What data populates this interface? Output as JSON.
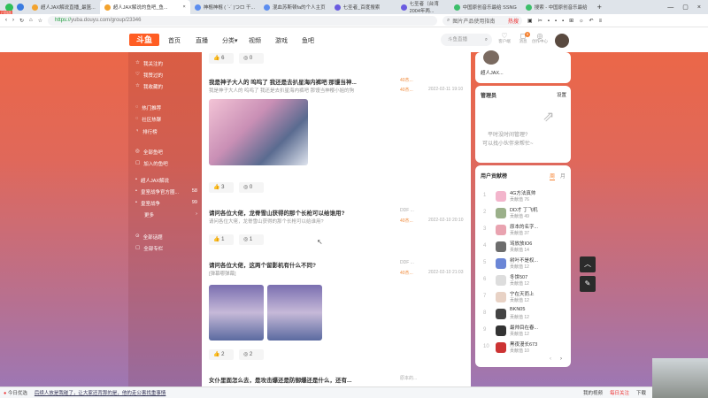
{
  "browser": {
    "tabs": [
      "超人JAX解说直播_最篮...",
      "超人JAX解说的鱼吧_鱼...",
      "神棍神棍 ( `-´ )つロ 干...",
      "混血苏斯顿fa的个人主页",
      "七圣者_百度搜索",
      "七圣者（台湾2004年两...",
      "中国原创音乐最给 SSNG",
      "搜索 - 中国原创音乐最给"
    ],
    "url_prefix": "https://",
    "url": "yuba.douyu.com/group/23346",
    "search_placeholder": "图片产品使用指南",
    "hot": "热搜",
    "badge": "已回声"
  },
  "header": {
    "logo": "斗鱼",
    "nav": [
      "首页",
      "直播",
      "分类▾",
      "视频",
      "游戏",
      "鱼吧"
    ],
    "search_placeholder": "斗鱼直播",
    "icons": [
      {
        "name": "client-icon",
        "label": "客户端"
      },
      {
        "name": "bell-icon",
        "label": "消息",
        "badge": "9"
      },
      {
        "name": "creator-icon",
        "label": "创作中心"
      }
    ]
  },
  "sidebar": {
    "items": [
      {
        "icon": "star-icon",
        "label": "我关注的"
      },
      {
        "icon": "like-icon",
        "label": "我赞过的"
      },
      {
        "icon": "collect-icon",
        "label": "我收藏的"
      },
      {
        "icon": "fire-icon",
        "label": "热门推荐"
      },
      {
        "icon": "chat-icon",
        "label": "社区热聊"
      },
      {
        "icon": "trophy-icon",
        "label": "排行榜"
      },
      {
        "icon": "group-icon",
        "label": "全部鱼吧"
      },
      {
        "icon": "joined-icon",
        "label": "加入的鱼吧"
      },
      {
        "icon": "dot",
        "label": "超人JAX解说",
        "count": ""
      },
      {
        "icon": "dot",
        "label": "皇室战争官方圈...",
        "count": "58"
      },
      {
        "icon": "dot",
        "label": "皇室战争",
        "count": "99"
      },
      {
        "icon": "",
        "label": "更多",
        "count": "›"
      },
      {
        "icon": "topic-icon",
        "label": "全部话题"
      },
      {
        "icon": "column-icon",
        "label": "全部专栏"
      }
    ]
  },
  "posts": [
    {
      "likes": "6",
      "comments": "0"
    },
    {
      "title": "我是神子大人的 呜呜了 我还是去扒星海内裤吧 那馒当神...",
      "sub": "我是神子大人的 呜呜了 我还是去扒星海内裤吧 那馒当神樱小姐的狗",
      "author": "40杰...",
      "level": "40杰...",
      "date": "2022-02-11 19:10",
      "likes": "3",
      "comments": "0"
    },
    {
      "title": "请问各位大佬，龙脊雪山获得的那个长枪可以给谁用?",
      "sub": "请问各位大佬，龙脊雪山获得的那个长枪可以给谁用?",
      "author": "DDF ...",
      "level": "40杰...",
      "date": "2022-02-10 20:10",
      "likes": "1",
      "comments": "1"
    },
    {
      "title": "请问各位大佬，这两个留影机有什么不同?",
      "sub": "[弹幕哪弹幕]",
      "author": "DDF ...",
      "level": "40杰...",
      "date": "2022-02-10 21:03",
      "likes": "2",
      "comments": "2"
    },
    {
      "title": "女仆里面怎么去，是攻击爆还是防御爆还是什么，还有...",
      "author": "原本的..."
    }
  ],
  "right": {
    "owner": "超人JAX...",
    "admin_title": "管理员",
    "admin_setting": "设置",
    "admin_note1": "平时没时间管理?",
    "admin_note2": "可以找小伙伴来帮忙~",
    "rank_title": "用户贡献榜",
    "tab_week": "周",
    "tab_month": "月",
    "ranks": [
      {
        "n": "1",
        "name": "4G方法真帅",
        "score": "贡献值 76"
      },
      {
        "n": "2",
        "name": "DD才 丁飞机",
        "score": "贡献值 49"
      },
      {
        "n": "3",
        "name": "原本的名字...",
        "score": "贡献值 37"
      },
      {
        "n": "4",
        "name": "骂放放IO6",
        "score": "贡献值 14"
      },
      {
        "n": "5",
        "name": "树叶不是权...",
        "score": "贡献值 12"
      },
      {
        "n": "6",
        "name": "冬饼507",
        "score": "贡献值 12"
      },
      {
        "n": "7",
        "name": "宁在天而上",
        "score": "贡献值 12"
      },
      {
        "n": "8",
        "name": "BKN05",
        "score": "贡献值 12"
      },
      {
        "n": "9",
        "name": "最帅目在春...",
        "score": "贡献值 12"
      },
      {
        "n": "10",
        "name": "黑夜漫长673",
        "score": "贡献值 10"
      }
    ]
  },
  "status": {
    "left": "今日优选",
    "news": "后续人放是我碰了，让大家还背那的是，他的走公害找重事情",
    "video": "我的视频",
    "follow": "每日关注",
    "download": "下载"
  }
}
